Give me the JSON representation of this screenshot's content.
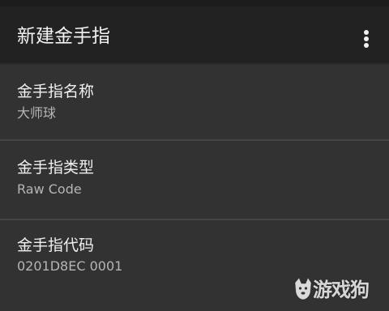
{
  "app_bar": {
    "title": "新建金手指",
    "menu_icon": "more-vert-icon"
  },
  "fields": [
    {
      "label": "金手指名称",
      "value": "大师球"
    },
    {
      "label": "金手指类型",
      "value": "Raw Code"
    },
    {
      "label": "金手指代码",
      "value": "0201D8EC 0001"
    }
  ],
  "watermark": {
    "text": "游戏狗",
    "icon": "dog-logo-icon"
  },
  "colors": {
    "background": "#323232",
    "app_bar": "#222222",
    "divider": "#454545",
    "primary_text": "#f0f0f0",
    "secondary_text": "#b5b5b5"
  }
}
